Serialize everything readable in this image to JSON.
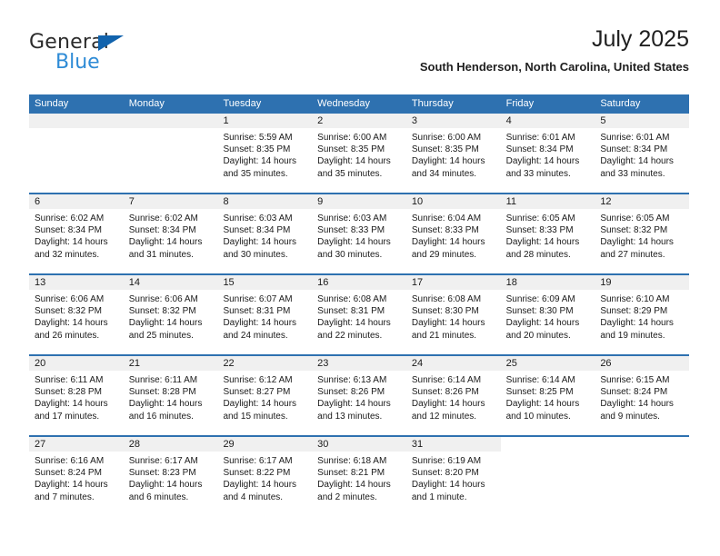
{
  "brand": {
    "name_top": "General",
    "name_bottom": "Blue",
    "accent_dark_blue": "#1163ad",
    "accent_light_blue": "#2e8bd6"
  },
  "header": {
    "title": "July 2025",
    "location": "South Henderson, North Carolina, United States"
  },
  "theme": {
    "header_blue": "#2e71b0",
    "day_band_gray": "#f0f0f0",
    "text": "#1a1a1a"
  },
  "labels": {
    "sunrise": "Sunrise:",
    "sunset": "Sunset:",
    "daylight": "Daylight:"
  },
  "weekdays": [
    "Sunday",
    "Monday",
    "Tuesday",
    "Wednesday",
    "Thursday",
    "Friday",
    "Saturday"
  ],
  "weeks": [
    [
      {
        "day": "",
        "empty": true
      },
      {
        "day": "",
        "empty": true
      },
      {
        "day": "1",
        "sunrise": "Sunrise: 5:59 AM",
        "sunset": "Sunset: 8:35 PM",
        "daylight": "Daylight: 14 hours and 35 minutes."
      },
      {
        "day": "2",
        "sunrise": "Sunrise: 6:00 AM",
        "sunset": "Sunset: 8:35 PM",
        "daylight": "Daylight: 14 hours and 35 minutes."
      },
      {
        "day": "3",
        "sunrise": "Sunrise: 6:00 AM",
        "sunset": "Sunset: 8:35 PM",
        "daylight": "Daylight: 14 hours and 34 minutes."
      },
      {
        "day": "4",
        "sunrise": "Sunrise: 6:01 AM",
        "sunset": "Sunset: 8:34 PM",
        "daylight": "Daylight: 14 hours and 33 minutes."
      },
      {
        "day": "5",
        "sunrise": "Sunrise: 6:01 AM",
        "sunset": "Sunset: 8:34 PM",
        "daylight": "Daylight: 14 hours and 33 minutes."
      }
    ],
    [
      {
        "day": "6",
        "sunrise": "Sunrise: 6:02 AM",
        "sunset": "Sunset: 8:34 PM",
        "daylight": "Daylight: 14 hours and 32 minutes."
      },
      {
        "day": "7",
        "sunrise": "Sunrise: 6:02 AM",
        "sunset": "Sunset: 8:34 PM",
        "daylight": "Daylight: 14 hours and 31 minutes."
      },
      {
        "day": "8",
        "sunrise": "Sunrise: 6:03 AM",
        "sunset": "Sunset: 8:34 PM",
        "daylight": "Daylight: 14 hours and 30 minutes."
      },
      {
        "day": "9",
        "sunrise": "Sunrise: 6:03 AM",
        "sunset": "Sunset: 8:33 PM",
        "daylight": "Daylight: 14 hours and 30 minutes."
      },
      {
        "day": "10",
        "sunrise": "Sunrise: 6:04 AM",
        "sunset": "Sunset: 8:33 PM",
        "daylight": "Daylight: 14 hours and 29 minutes."
      },
      {
        "day": "11",
        "sunrise": "Sunrise: 6:05 AM",
        "sunset": "Sunset: 8:33 PM",
        "daylight": "Daylight: 14 hours and 28 minutes."
      },
      {
        "day": "12",
        "sunrise": "Sunrise: 6:05 AM",
        "sunset": "Sunset: 8:32 PM",
        "daylight": "Daylight: 14 hours and 27 minutes."
      }
    ],
    [
      {
        "day": "13",
        "sunrise": "Sunrise: 6:06 AM",
        "sunset": "Sunset: 8:32 PM",
        "daylight": "Daylight: 14 hours and 26 minutes."
      },
      {
        "day": "14",
        "sunrise": "Sunrise: 6:06 AM",
        "sunset": "Sunset: 8:32 PM",
        "daylight": "Daylight: 14 hours and 25 minutes."
      },
      {
        "day": "15",
        "sunrise": "Sunrise: 6:07 AM",
        "sunset": "Sunset: 8:31 PM",
        "daylight": "Daylight: 14 hours and 24 minutes."
      },
      {
        "day": "16",
        "sunrise": "Sunrise: 6:08 AM",
        "sunset": "Sunset: 8:31 PM",
        "daylight": "Daylight: 14 hours and 22 minutes."
      },
      {
        "day": "17",
        "sunrise": "Sunrise: 6:08 AM",
        "sunset": "Sunset: 8:30 PM",
        "daylight": "Daylight: 14 hours and 21 minutes."
      },
      {
        "day": "18",
        "sunrise": "Sunrise: 6:09 AM",
        "sunset": "Sunset: 8:30 PM",
        "daylight": "Daylight: 14 hours and 20 minutes."
      },
      {
        "day": "19",
        "sunrise": "Sunrise: 6:10 AM",
        "sunset": "Sunset: 8:29 PM",
        "daylight": "Daylight: 14 hours and 19 minutes."
      }
    ],
    [
      {
        "day": "20",
        "sunrise": "Sunrise: 6:11 AM",
        "sunset": "Sunset: 8:28 PM",
        "daylight": "Daylight: 14 hours and 17 minutes."
      },
      {
        "day": "21",
        "sunrise": "Sunrise: 6:11 AM",
        "sunset": "Sunset: 8:28 PM",
        "daylight": "Daylight: 14 hours and 16 minutes."
      },
      {
        "day": "22",
        "sunrise": "Sunrise: 6:12 AM",
        "sunset": "Sunset: 8:27 PM",
        "daylight": "Daylight: 14 hours and 15 minutes."
      },
      {
        "day": "23",
        "sunrise": "Sunrise: 6:13 AM",
        "sunset": "Sunset: 8:26 PM",
        "daylight": "Daylight: 14 hours and 13 minutes."
      },
      {
        "day": "24",
        "sunrise": "Sunrise: 6:14 AM",
        "sunset": "Sunset: 8:26 PM",
        "daylight": "Daylight: 14 hours and 12 minutes."
      },
      {
        "day": "25",
        "sunrise": "Sunrise: 6:14 AM",
        "sunset": "Sunset: 8:25 PM",
        "daylight": "Daylight: 14 hours and 10 minutes."
      },
      {
        "day": "26",
        "sunrise": "Sunrise: 6:15 AM",
        "sunset": "Sunset: 8:24 PM",
        "daylight": "Daylight: 14 hours and 9 minutes."
      }
    ],
    [
      {
        "day": "27",
        "sunrise": "Sunrise: 6:16 AM",
        "sunset": "Sunset: 8:24 PM",
        "daylight": "Daylight: 14 hours and 7 minutes."
      },
      {
        "day": "28",
        "sunrise": "Sunrise: 6:17 AM",
        "sunset": "Sunset: 8:23 PM",
        "daylight": "Daylight: 14 hours and 6 minutes."
      },
      {
        "day": "29",
        "sunrise": "Sunrise: 6:17 AM",
        "sunset": "Sunset: 8:22 PM",
        "daylight": "Daylight: 14 hours and 4 minutes."
      },
      {
        "day": "30",
        "sunrise": "Sunrise: 6:18 AM",
        "sunset": "Sunset: 8:21 PM",
        "daylight": "Daylight: 14 hours and 2 minutes."
      },
      {
        "day": "31",
        "sunrise": "Sunrise: 6:19 AM",
        "sunset": "Sunset: 8:20 PM",
        "daylight": "Daylight: 14 hours and 1 minute."
      },
      {
        "day": "",
        "empty": true,
        "blank": true
      },
      {
        "day": "",
        "empty": true,
        "blank": true
      }
    ]
  ]
}
